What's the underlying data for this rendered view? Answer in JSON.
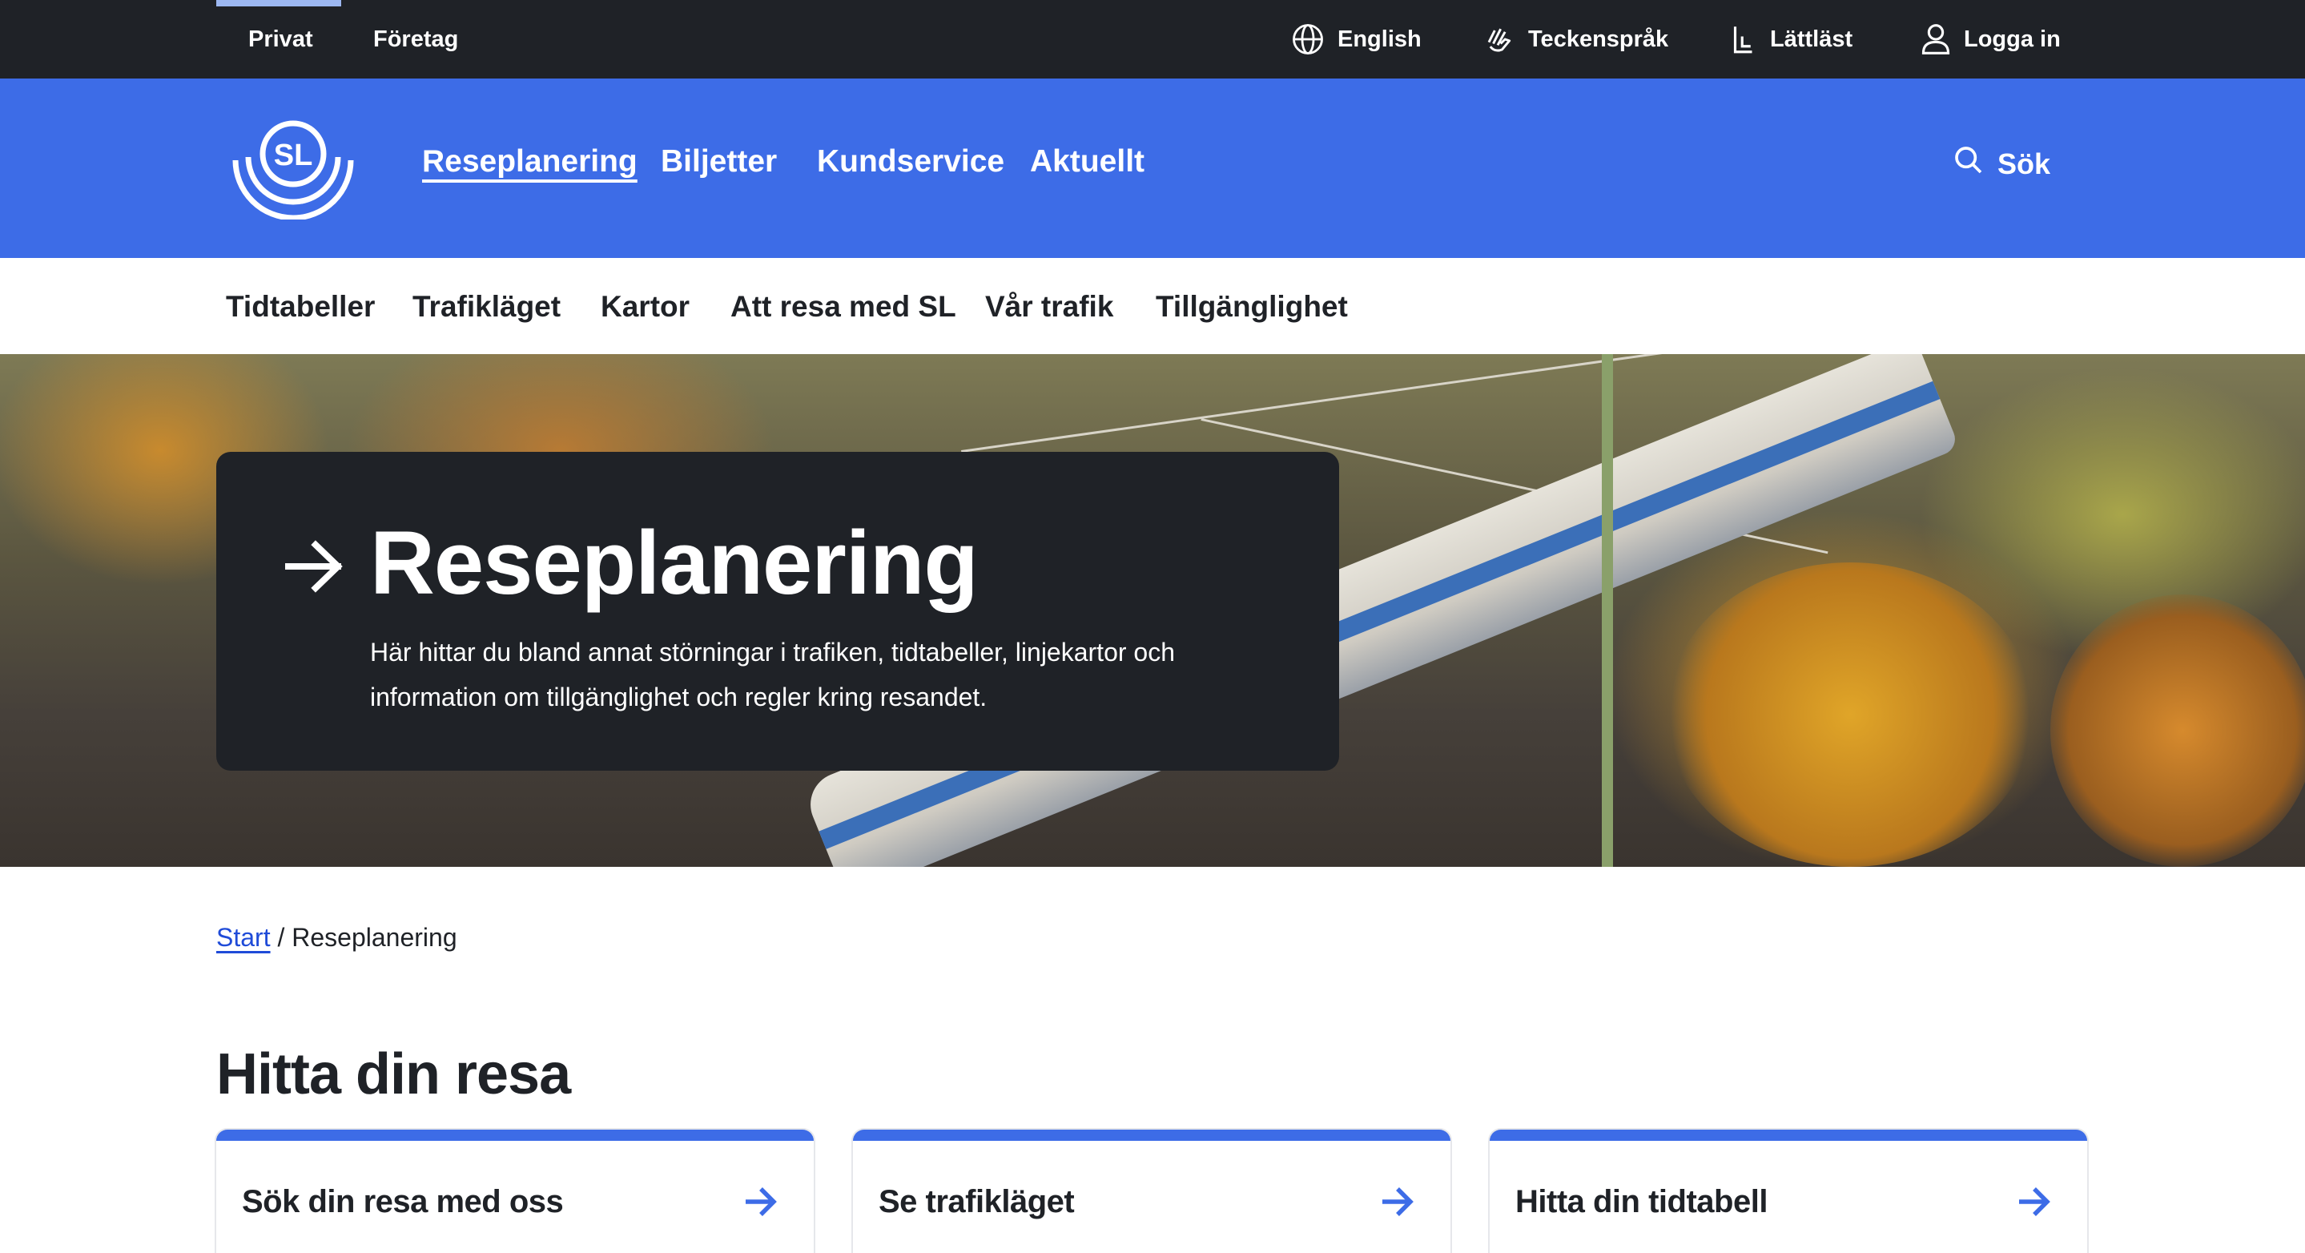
{
  "topbar": {
    "segments": [
      "Privat",
      "Företag"
    ],
    "links": [
      {
        "label": "English",
        "icon": "globe-icon"
      },
      {
        "label": "Teckenspråk",
        "icon": "sign-language-icon"
      },
      {
        "label": "Lättläst",
        "icon": "easy-read-icon"
      },
      {
        "label": "Logga in",
        "icon": "user-icon"
      }
    ]
  },
  "header": {
    "logo_text": "SL",
    "nav": [
      "Reseplanering",
      "Biljetter",
      "Kundservice",
      "Aktuellt"
    ],
    "search_label": "Sök"
  },
  "subnav": [
    "Tidtabeller",
    "Trafikläget",
    "Kartor",
    "Att resa med SL",
    "Vår trafik",
    "Tillgänglighet"
  ],
  "hero": {
    "title": "Reseplanering",
    "description": "Här hittar du bland annat störningar i trafiken, tidtabeller, linjekartor och information om tillgänglighet och regler kring resandet."
  },
  "breadcrumb": {
    "home": "Start",
    "separator": "/",
    "current": "Reseplanering"
  },
  "section": {
    "title": "Hitta din resa",
    "cards": [
      "Sök din resa med oss",
      "Se trafikläget",
      "Hitta din tidtabell"
    ]
  },
  "colors": {
    "brand_blue": "#3d6ce7",
    "dark": "#1f2227",
    "link_blue": "#1f4bd8"
  }
}
